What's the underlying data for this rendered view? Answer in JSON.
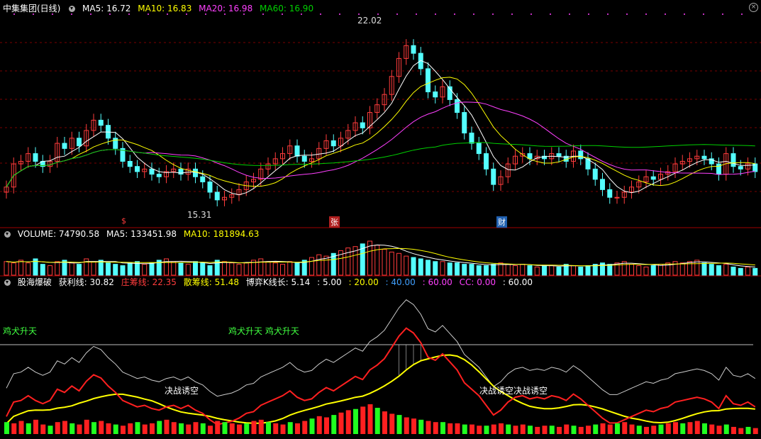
{
  "price_header": {
    "title": "中集集团(日线)",
    "ma5": "MA5: 16.72",
    "ma10": "MA10: 16.83",
    "ma20": "MA20: 16.98",
    "ma60": "MA60: 16.90"
  },
  "price_labels": {
    "high": "22.02",
    "low": "15.31"
  },
  "markers": {
    "m1": "$",
    "m2": "张",
    "m3": "财"
  },
  "volume_header": {
    "title": "VOLUME: 74790.58",
    "ma5": "MA5: 133451.98",
    "ma10": "MA10: 181894.63"
  },
  "indicator_header": {
    "name": "股海爆破",
    "profit": "获利线: 30.82",
    "dealer": "庄筹线: 22.35",
    "retail": "散筹线: 51.48",
    "game": "博弈K线长: 5.14",
    "v1": ": 5.00",
    "v2": ": 20.00",
    "v3": ": 40.00",
    "v4": ": 60.00",
    "cc": "CC: 0.00",
    "v5": ": 60.00"
  },
  "annotations": {
    "rise1": "鸡犬升天",
    "rise2": "鸡犬升天 鸡犬升天",
    "bear1": "决战诱空",
    "bear2": "决战诱空决战诱空"
  },
  "colors": {
    "up": "#ff3c3c",
    "down": "#54ffff",
    "ma5": "#ffffff",
    "ma10": "#ffff00",
    "ma20": "#ff40ff",
    "ma60": "#00d000",
    "grid": "#7a0000"
  },
  "chart_data": {
    "type": "candlestick",
    "title": "中集集团(日线)",
    "close": [
      16.0,
      16.9,
      17.0,
      17.3,
      17.0,
      16.8,
      17.0,
      17.7,
      17.5,
      17.9,
      17.6,
      18.2,
      18.6,
      18.4,
      17.9,
      17.5,
      17.0,
      16.8,
      16.6,
      16.7,
      16.5,
      16.4,
      16.6,
      16.7,
      16.5,
      16.7,
      16.4,
      16.2,
      15.8,
      15.5,
      15.6,
      15.7,
      15.9,
      16.2,
      16.3,
      16.7,
      16.9,
      17.1,
      17.3,
      17.6,
      17.2,
      17.0,
      17.1,
      17.5,
      17.8,
      17.6,
      17.9,
      18.2,
      18.5,
      18.3,
      18.9,
      19.2,
      19.6,
      20.3,
      21.0,
      21.5,
      21.2,
      20.6,
      19.7,
      19.5,
      19.9,
      19.4,
      18.9,
      18.1,
      17.7,
      17.3,
      16.7,
      16.1,
      16.4,
      16.9,
      17.2,
      17.3,
      17.1,
      17.2,
      17.1,
      17.3,
      17.2,
      17.0,
      17.4,
      17.1,
      16.7,
      16.3,
      15.9,
      15.6,
      15.6,
      15.8,
      16.0,
      16.2,
      16.4,
      16.3,
      16.5,
      16.6,
      16.9,
      17.0,
      17.1,
      17.2,
      17.1,
      16.9,
      16.5,
      17.3,
      16.8,
      16.7,
      16.9,
      16.6
    ],
    "volume": [
      1.0,
      0.9,
      1.1,
      0.9,
      1.2,
      0.8,
      0.7,
      1.0,
      1.1,
      0.9,
      0.8,
      1.2,
      1.0,
      1.1,
      0.9,
      0.8,
      0.7,
      0.9,
      1.0,
      0.8,
      0.9,
      1.1,
      1.2,
      1.0,
      0.9,
      0.8,
      1.0,
      0.9,
      0.7,
      1.1,
      1.0,
      0.9,
      0.8,
      0.9,
      1.1,
      1.2,
      1.0,
      0.9,
      0.8,
      1.0,
      0.9,
      1.1,
      1.3,
      1.5,
      1.4,
      1.6,
      1.8,
      2.0,
      2.1,
      2.3,
      2.5,
      2.2,
      1.9,
      1.7,
      1.6,
      1.4,
      1.3,
      1.2,
      1.1,
      1.0,
      1.0,
      0.9,
      0.9,
      0.8,
      0.8,
      0.7,
      0.7,
      0.8,
      0.9,
      0.8,
      0.7,
      0.8,
      0.7,
      0.6,
      0.7,
      0.7,
      0.6,
      0.8,
      0.7,
      0.6,
      0.7,
      0.8,
      0.9,
      0.8,
      0.9,
      1.0,
      0.8,
      0.7,
      0.6,
      0.7,
      0.8,
      0.9,
      1.0,
      0.9,
      1.0,
      1.1,
      0.9,
      0.8,
      0.7,
      0.8,
      0.6,
      0.5,
      0.6,
      0.5
    ],
    "ylim": [
      15.0,
      22.5
    ]
  }
}
